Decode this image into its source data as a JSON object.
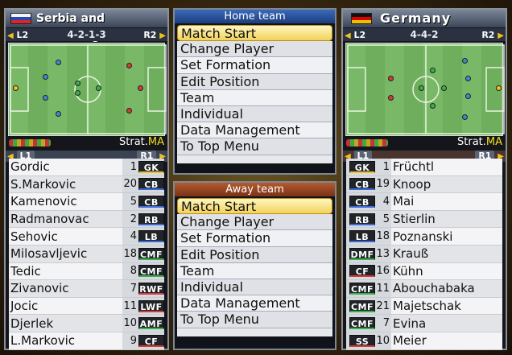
{
  "home_team": {
    "name": "Serbia and Montenegro",
    "formation": "4-2-1-3",
    "l_btn": "L2",
    "r_btn": "R2",
    "strategy_label": "Strat.",
    "strategy_value": "MA",
    "list_l_btn": "L1",
    "list_r_btn": "R1",
    "players": [
      {
        "name": "Gordic",
        "number": "1",
        "position": "GK",
        "pos_type": "gk"
      },
      {
        "name": "S.Markovic",
        "number": "20",
        "position": "CB",
        "pos_type": "df"
      },
      {
        "name": "Kamenovic",
        "number": "5",
        "position": "CB",
        "pos_type": "df"
      },
      {
        "name": "Radmanovac",
        "number": "2",
        "position": "RB",
        "pos_type": "df"
      },
      {
        "name": "Sehovic",
        "number": "4",
        "position": "LB",
        "pos_type": "df"
      },
      {
        "name": "Milosavljevic",
        "number": "18",
        "position": "CMF",
        "pos_type": "mf"
      },
      {
        "name": "Tedic",
        "number": "8",
        "position": "CMF",
        "pos_type": "mf"
      },
      {
        "name": "Zivanovic",
        "number": "7",
        "position": "RWF",
        "pos_type": "fw"
      },
      {
        "name": "Jocic",
        "number": "11",
        "position": "LWF",
        "pos_type": "fw"
      },
      {
        "name": "Djerlek",
        "number": "10",
        "position": "AMF",
        "pos_type": "mf"
      },
      {
        "name": "L.Markovic",
        "number": "9",
        "position": "CF",
        "pos_type": "fw"
      }
    ]
  },
  "away_team": {
    "name": "Germany",
    "formation": "4-4-2",
    "l_btn": "L2",
    "r_btn": "R2",
    "strategy_label": "Strat.",
    "strategy_value": "MA",
    "list_l_btn": "L1",
    "list_r_btn": "R1",
    "players": [
      {
        "name": "Früchtl",
        "number": "1",
        "position": "GK",
        "pos_type": "gk"
      },
      {
        "name": "Knoop",
        "number": "19",
        "position": "CB",
        "pos_type": "df"
      },
      {
        "name": "Mai",
        "number": "4",
        "position": "CB",
        "pos_type": "df"
      },
      {
        "name": "Stierlin",
        "number": "5",
        "position": "RB",
        "pos_type": "df"
      },
      {
        "name": "Poznanski",
        "number": "18",
        "position": "LB",
        "pos_type": "df"
      },
      {
        "name": "Krauß",
        "number": "13",
        "position": "DMF",
        "pos_type": "mf"
      },
      {
        "name": "Kühn",
        "number": "16",
        "position": "CF",
        "pos_type": "fw"
      },
      {
        "name": "Abouchabaka",
        "number": "11",
        "position": "CMF",
        "pos_type": "mf"
      },
      {
        "name": "Majetschak",
        "number": "21",
        "position": "CMF",
        "pos_type": "mf"
      },
      {
        "name": "Evina",
        "number": "7",
        "position": "CMF",
        "pos_type": "mf"
      },
      {
        "name": "Meier",
        "number": "10",
        "position": "SS",
        "pos_type": "fw"
      }
    ]
  },
  "home_menu": {
    "title": "Home team",
    "items": [
      "Match Start",
      "Change Player",
      "Set Formation",
      "Edit Position",
      "Team",
      "Individual",
      "Data Management",
      "To Top Menu"
    ]
  },
  "away_menu": {
    "title": "Away team",
    "items": [
      "Match Start",
      "Change Player",
      "Set Formation",
      "Edit Position",
      "Team",
      "Individual",
      "Data Management",
      "To Top Menu"
    ]
  },
  "colors": {
    "gk": "#f0c020",
    "df": "#3a6ad8",
    "mf": "#3ab04a",
    "fw": "#d83a3a"
  }
}
